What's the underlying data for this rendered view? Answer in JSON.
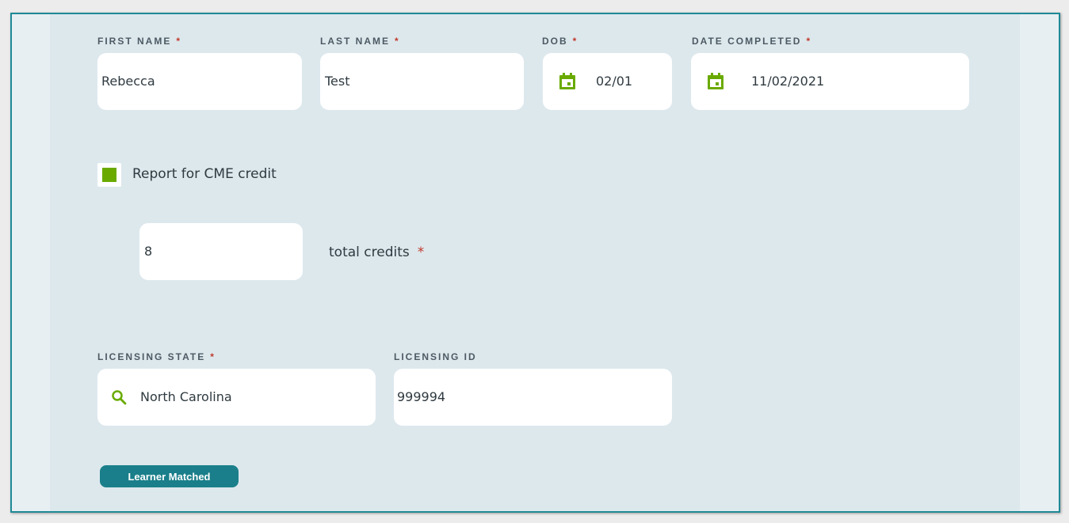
{
  "form": {
    "first_name": {
      "label": "FIRST NAME",
      "value": "Rebecca"
    },
    "last_name": {
      "label": "LAST NAME",
      "value": "Test"
    },
    "dob": {
      "label": "DOB",
      "value": "02/01"
    },
    "date_completed": {
      "label": "DATE COMPLETED",
      "value": "11/02/2021"
    },
    "required_mark": "*",
    "cme": {
      "label": "Report for CME credit",
      "checked": true
    },
    "credits": {
      "value": "8",
      "label": "total credits"
    },
    "licensing_state": {
      "label": "LICENSING STATE",
      "value": "North Carolina"
    },
    "licensing_id": {
      "label": "LICENSING ID",
      "value": "999994"
    },
    "status_badge": "Learner Matched"
  },
  "icons": {
    "calendar": "calendar-icon",
    "search": "search-icon",
    "check": "checkbox-checked"
  },
  "colors": {
    "accent_green": "#6aaa00",
    "teal": "#1a7f8a",
    "required_red": "#c0392b",
    "panel_bg": "#dde8ed"
  }
}
